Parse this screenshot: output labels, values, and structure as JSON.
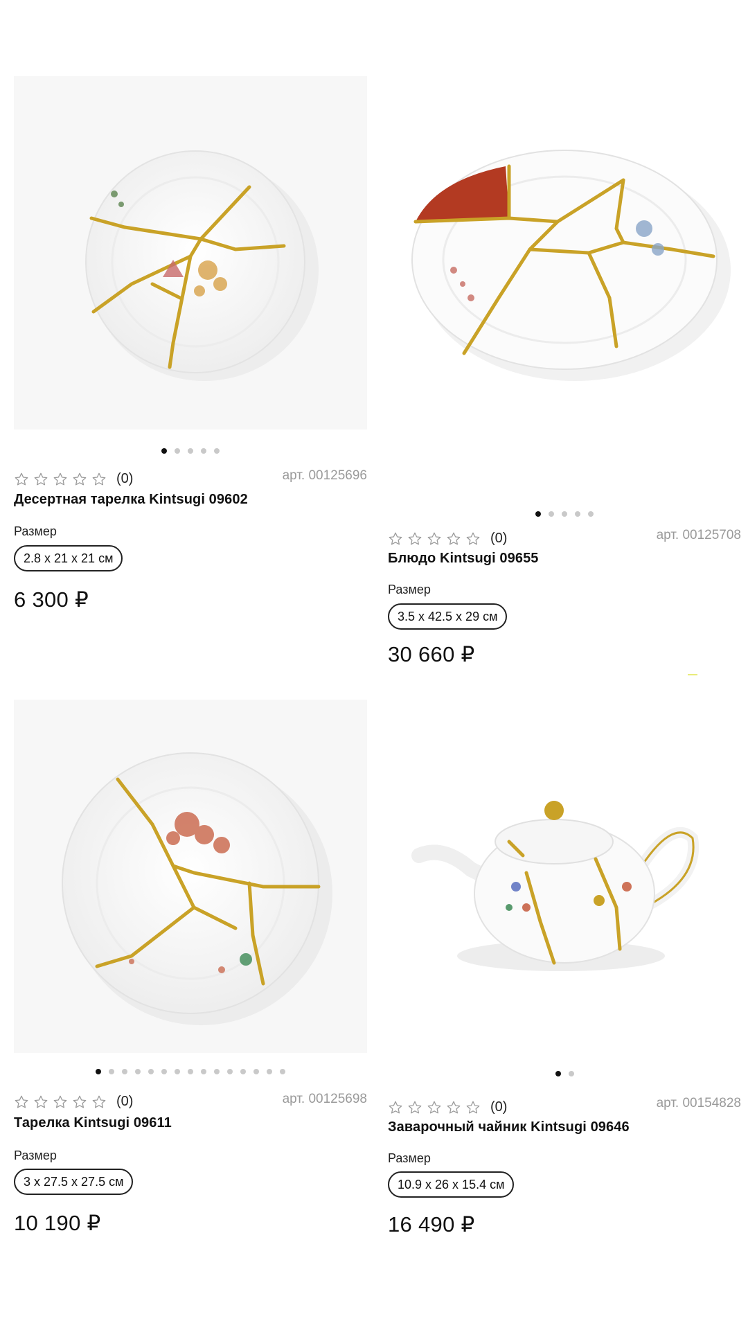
{
  "products": [
    {
      "sku": "арт. 00125696",
      "title": "Десертная тарелка Kintsugi 09602",
      "rating_count": "(0)",
      "size_label": "Размер",
      "size_value": "2.8 x 21 x 21 см",
      "price": "6 300 ₽",
      "image_icon": "dessert-plate",
      "dots_total": 5,
      "dot_active": 0
    },
    {
      "sku": "арт. 00125708",
      "title": "Блюдо Kintsugi 09655",
      "rating_count": "(0)",
      "size_label": "Размер",
      "size_value": "3.5 x 42.5 x 29 см",
      "price": "30 660 ₽",
      "image_icon": "oval-dish",
      "dots_total": 5,
      "dot_active": 0
    },
    {
      "sku": "арт. 00125698",
      "title": "Тарелка Kintsugi 09611",
      "rating_count": "(0)",
      "size_label": "Размер",
      "size_value": "3 x 27.5 x 27.5 см",
      "price": "10 190 ₽",
      "image_icon": "plate",
      "dots_total": 15,
      "dot_active": 0
    },
    {
      "sku": "арт. 00154828",
      "title": "Заварочный чайник Kintsugi 09646",
      "rating_count": "(0)",
      "size_label": "Размер",
      "size_value": "10.9 x 26 x 15.4 см",
      "price": "16 490 ₽",
      "image_icon": "teapot",
      "dots_total": 2,
      "dot_active": 0
    }
  ],
  "rating_stars": 5,
  "colors": {
    "gold": "#c9a227",
    "text": "#111111",
    "muted": "#9a9a9a",
    "dot_inactive": "#c9c9c9",
    "red_glaze": "#b33a22"
  }
}
